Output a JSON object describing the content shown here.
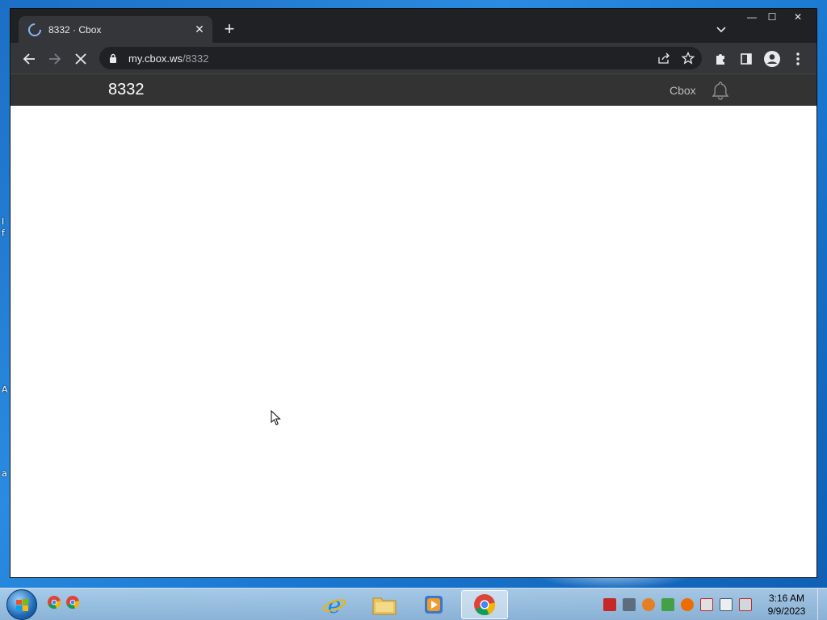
{
  "browser": {
    "tab": {
      "title": "8332 · Cbox",
      "close_glyph": "✕"
    },
    "new_tab_glyph": "+",
    "url": {
      "host": "my.cbox.ws",
      "path": "/8332"
    },
    "window_controls": {
      "minimize": "—",
      "maximize": "☐",
      "close": "✕"
    }
  },
  "site": {
    "title": "8332",
    "brand": "Cbox"
  },
  "desktop": {
    "edge_letters": [
      "I",
      "f",
      "A",
      "a"
    ]
  },
  "taskbar": {
    "clock_time": "3:16 AM",
    "clock_date": "9/9/2023",
    "pinned_apps": [
      "internet-explorer",
      "file-explorer",
      "media-player",
      "chrome"
    ],
    "tray_icons": [
      "acrobat-icon",
      "tools-icon",
      "search-icon",
      "utorrent-icon",
      "update-icon",
      "flag-icon",
      "network-icon",
      "volume-muted-icon"
    ]
  }
}
